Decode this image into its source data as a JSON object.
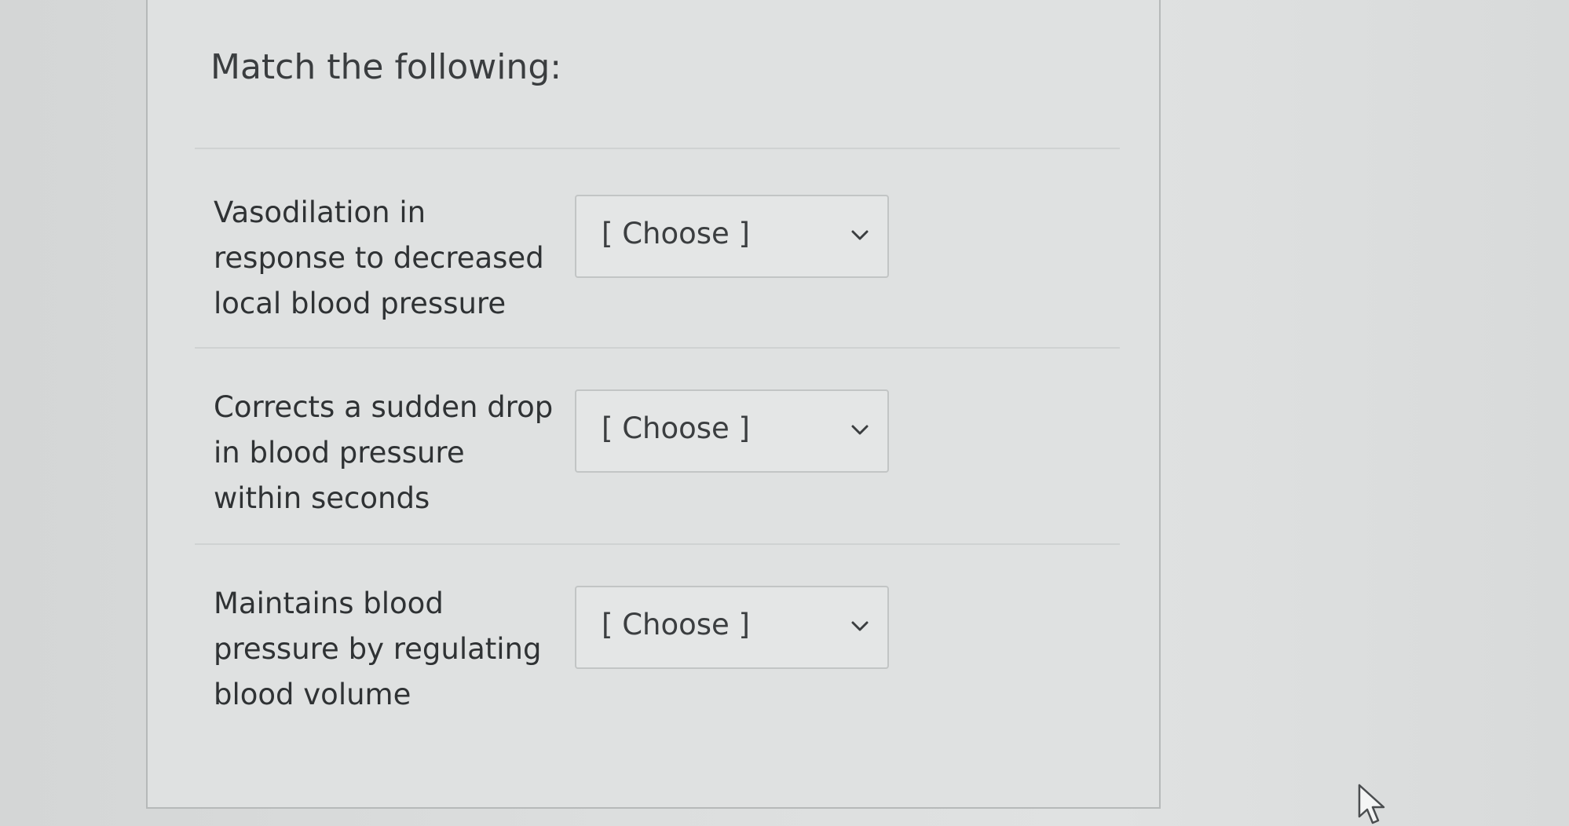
{
  "question": {
    "title": "Match the following:"
  },
  "rows": [
    {
      "prompt": "Vasodilation in response to decreased local blood pressure",
      "select_value": "[ Choose ]"
    },
    {
      "prompt": "Corrects a sudden drop in blood pressure within seconds",
      "select_value": "[ Choose ]"
    },
    {
      "prompt": "Maintains blood pressure by regulating blood volume",
      "select_value": "[ Choose ]"
    }
  ],
  "icons": {
    "dropdown": "chevron-down-icon",
    "cursor": "mouse-pointer-icon"
  },
  "colors": {
    "background": "#dcdede",
    "card": "#dfe1e1",
    "text": "#2f3234",
    "border": "#c2c5c5"
  }
}
